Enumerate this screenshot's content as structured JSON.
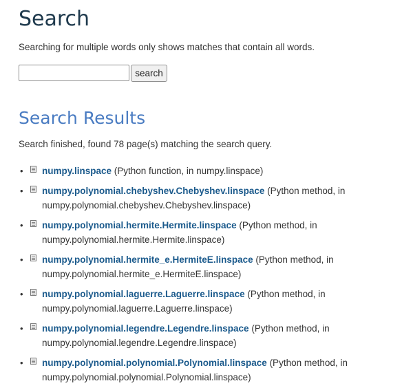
{
  "header": {
    "title": "Search",
    "hint": "Searching for multiple words only shows matches that contain all words."
  },
  "search": {
    "value": "",
    "placeholder": "",
    "button_label": "search"
  },
  "results": {
    "title": "Search Results",
    "status": "Search finished, found 78 page(s) matching the search query.",
    "items": [
      {
        "link": "numpy.linspace",
        "desc": " (Python function, in numpy.linspace)"
      },
      {
        "link": "numpy.polynomial.chebyshev.Chebyshev.linspace",
        "desc": " (Python method, in numpy.polynomial.chebyshev.Chebyshev.linspace)"
      },
      {
        "link": "numpy.polynomial.hermite.Hermite.linspace",
        "desc": " (Python method, in numpy.polynomial.hermite.Hermite.linspace)"
      },
      {
        "link": "numpy.polynomial.hermite_e.HermiteE.linspace",
        "desc": " (Python method, in numpy.polynomial.hermite_e.HermiteE.linspace)"
      },
      {
        "link": "numpy.polynomial.laguerre.Laguerre.linspace",
        "desc": " (Python method, in numpy.polynomial.laguerre.Laguerre.linspace)"
      },
      {
        "link": "numpy.polynomial.legendre.Legendre.linspace",
        "desc": " (Python method, in numpy.polynomial.legendre.Legendre.linspace)"
      },
      {
        "link": "numpy.polynomial.polynomial.Polynomial.linspace",
        "desc": " (Python method, in numpy.polynomial.polynomial.Polynomial.linspace)"
      }
    ]
  }
}
